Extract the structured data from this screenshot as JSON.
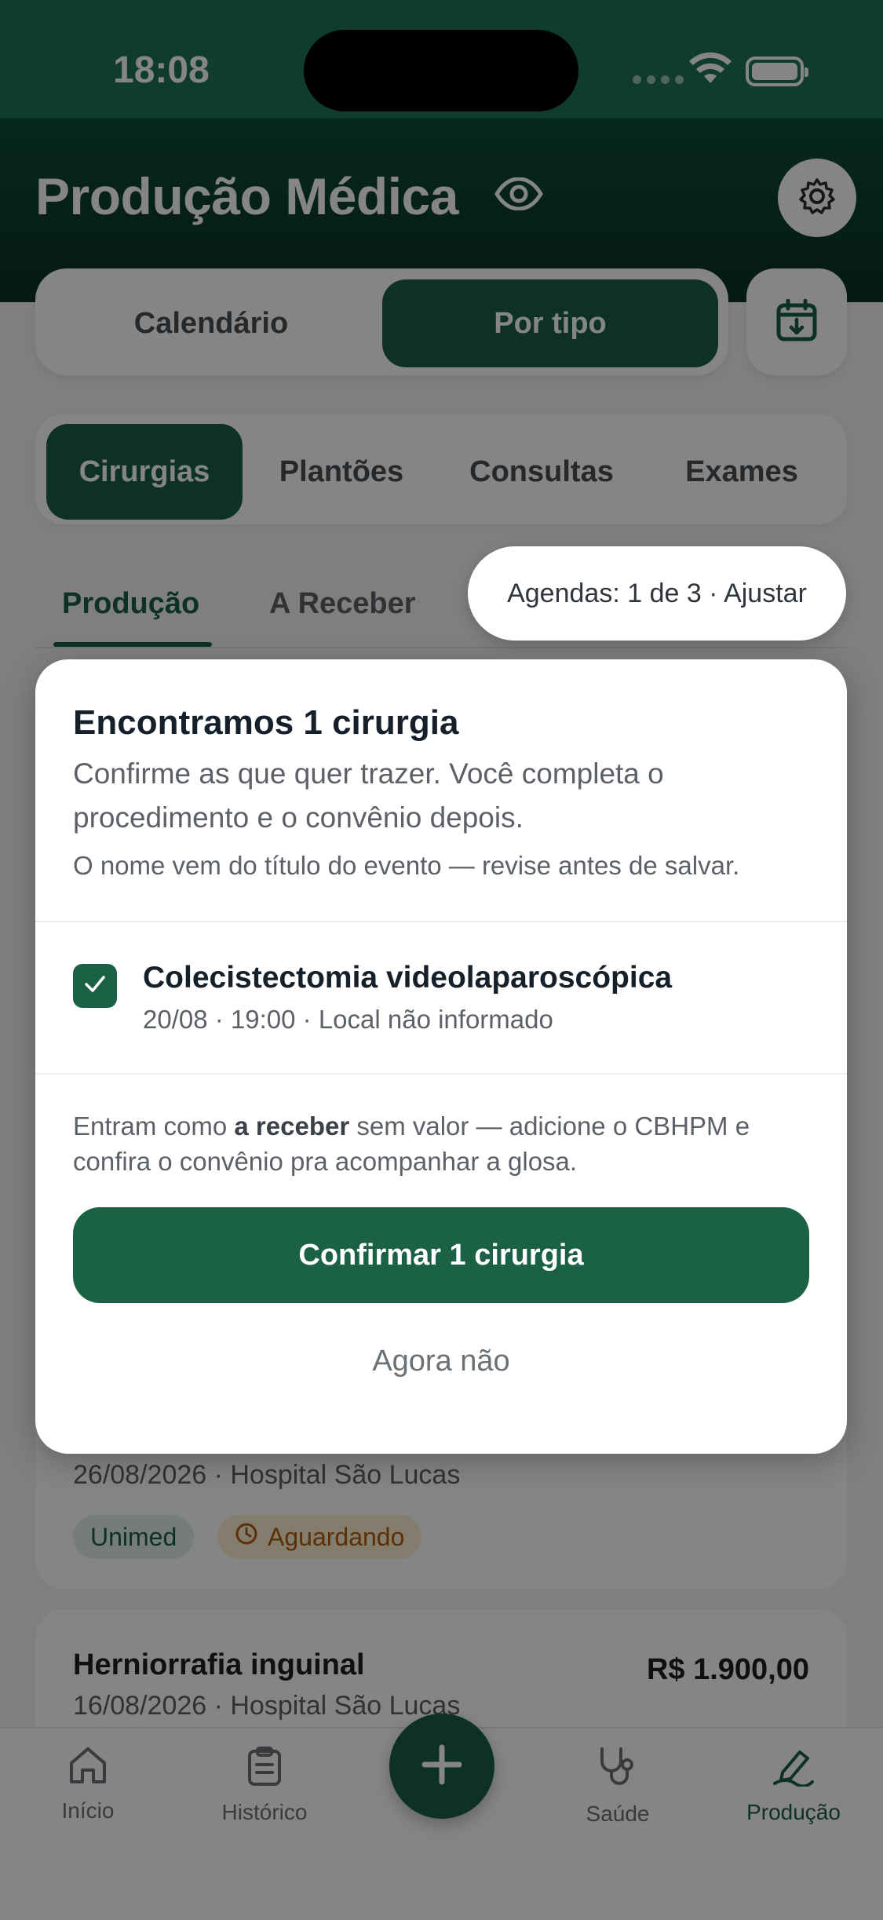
{
  "status": {
    "time": "18:08"
  },
  "header": {
    "title": "Produção Médica"
  },
  "view_toggle": {
    "items": [
      "Calendário",
      "Por tipo"
    ],
    "active": "Por tipo"
  },
  "categories": {
    "items": [
      "Cirurgias",
      "Plantões",
      "Consultas",
      "Exames"
    ],
    "active": "Cirurgias"
  },
  "subtabs": {
    "items": [
      "Produção",
      "A Receber"
    ],
    "active": "Produção"
  },
  "agendas_pill": "Agendas: 1 de 3 · Ajustar",
  "modal": {
    "title": "Encontramos 1 cirurgia",
    "description": "Confirme as que quer trazer. Você completa o procedimento e o convênio depois.",
    "note": "O nome vem do título do evento — revise antes de salvar.",
    "item": {
      "checked": true,
      "name": "Colecistectomia videolaparoscópica",
      "meta": "20/08 · 19:00 · Local não informado"
    },
    "info_prefix": "Entram como ",
    "info_bold": "a receber",
    "info_suffix": " sem valor — adicione o CBHPM e confira o convênio pra acompanhar a glosa.",
    "confirm_label": "Confirmar 1 cirurgia",
    "later_label": "Agora não"
  },
  "entries": [
    {
      "subtitle": "26/08/2026 · Hospital São Lucas",
      "insurer": "Unimed",
      "status": "Aguardando"
    },
    {
      "title": "Herniorrafia inguinal",
      "value": "R$ 1.900,00",
      "subtitle": "16/08/2026 · Hospital São Lucas"
    }
  ],
  "tabbar": {
    "items": [
      "Início",
      "Histórico",
      "Saúde",
      "Produção"
    ],
    "active": "Produção"
  },
  "colors": {
    "brand": "#1a6146",
    "header_dark": "#0a3325",
    "status_amber": "#b15a0e"
  }
}
